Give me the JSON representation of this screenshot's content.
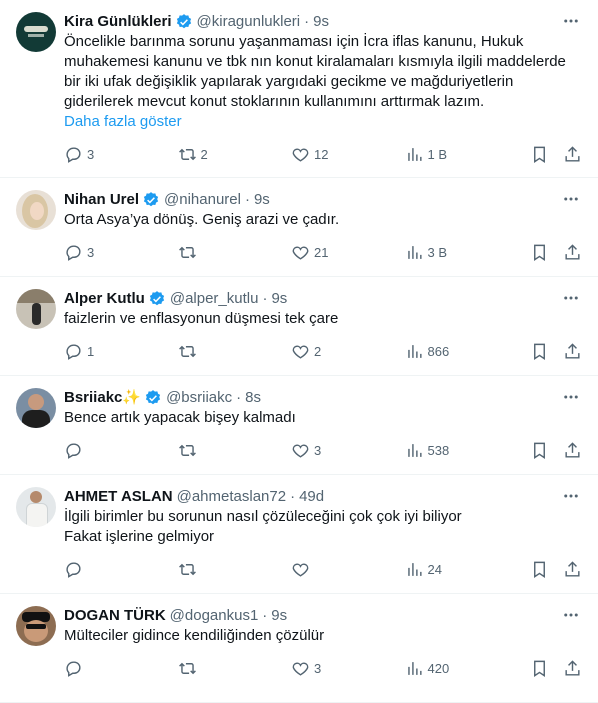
{
  "tweets": [
    {
      "name": "Kira Günlükleri",
      "handle": "@kiragunlukleri",
      "time": "9s",
      "lines": [
        "Öncelikle barınma sorunu yaşanmaması için İcra iflas kanunu, Hukuk",
        "muhakemesi kanunu ve tbk nın konut kiralamaları kısmıyla ilgili maddelerde",
        "bir iki ufak değişiklik yapılarak yargıdaki gecikme ve mağduriyetlerin",
        "giderilerek mevcut konut stoklarının kullanımını arttırmak lazım."
      ],
      "show_more": "Daha fazla göster",
      "replies": "3",
      "reposts": "2",
      "likes": "12",
      "views": "1 B"
    },
    {
      "name": "Nihan Urel",
      "handle": "@nihanurel",
      "time": "9s",
      "lines": [
        "Orta Asya’ya dönüş. Geniş arazi ve çadır."
      ],
      "replies": "3",
      "reposts": "",
      "likes": "21",
      "views": "3 B"
    },
    {
      "name": "Alper Kutlu",
      "handle": "@alper_kutlu",
      "time": "9s",
      "lines": [
        "faizlerin ve enflasyonun düşmesi tek çare"
      ],
      "replies": "1",
      "reposts": "",
      "likes": "2",
      "views": "866"
    },
    {
      "name": "Bsriiakc✨",
      "handle": "@bsriiakc",
      "time": "8s",
      "lines": [
        "Bence artık yapacak bişey kalmadı"
      ],
      "replies": "",
      "reposts": "",
      "likes": "3",
      "views": "538"
    },
    {
      "name": "AHMET ASLAN",
      "handle": "@ahmetaslan72",
      "time": "49d",
      "lines": [
        "İlgili birimler bu sorunun nasıl çözüleceğini çok çok iyi biliyor",
        "Fakat işlerine gelmiyor"
      ],
      "replies": "",
      "reposts": "",
      "likes": "",
      "views": "24"
    },
    {
      "name": "DOGAN TÜRK",
      "handle": "@dogankus1",
      "time": "9s",
      "lines": [
        "Mülteciler gidince kendiliğinden çözülür"
      ],
      "replies": "",
      "reposts": "",
      "likes": "3",
      "views": "420"
    }
  ],
  "colors": {
    "accent": "#1d9bf0",
    "muted": "#536471",
    "text": "#0f1419",
    "divider": "#eff3f4"
  },
  "icons": {
    "verified": "verified-badge-icon",
    "reply": "reply-icon",
    "repost": "repost-icon",
    "like": "heart-icon",
    "views": "views-icon",
    "bookmark": "bookmark-icon",
    "share": "share-icon",
    "more": "more-icon"
  }
}
